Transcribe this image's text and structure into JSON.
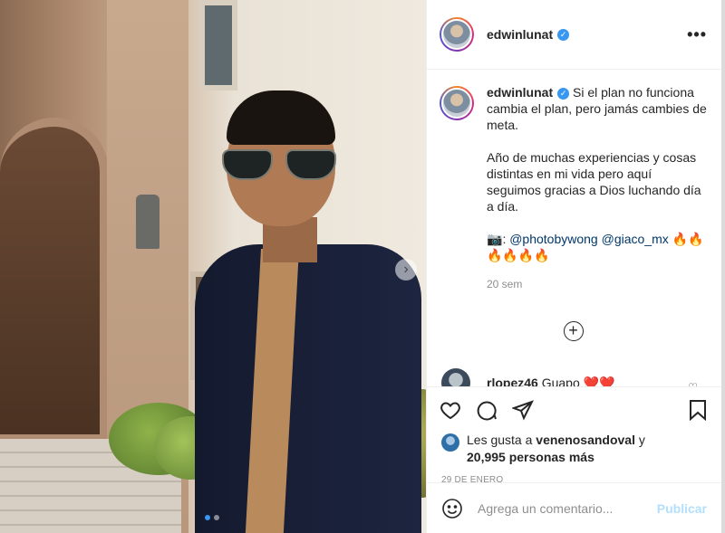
{
  "post": {
    "photo_alt": "Post photo",
    "carousel_dots": 2,
    "carousel_active": 1
  },
  "header": {
    "username": "edwinlunat",
    "verified_icon": "verified-badge-icon",
    "more_icon": "more-options-icon",
    "more_glyph": "•••"
  },
  "caption": {
    "username": "edwinlunat",
    "paragraph1": "Si el plan no funciona cambia el plan, pero jamás cambies de meta.",
    "paragraph2": "Año de muchas experiencias y cosas distintas en mi vida pero aquí seguimos gracias a Dios luchando día a día.",
    "camera_emoji": "📷",
    "credit_sep": ": ",
    "mention1": "@photobywong",
    "mention2": "@giaco_mx",
    "fire_emojis": "🔥🔥🔥🔥🔥🔥",
    "time": "20 sem"
  },
  "load_more": {
    "glyph": "+"
  },
  "comments": [
    {
      "username": "rlopez46",
      "text": "Guapo",
      "hearts": "❤️❤️"
    }
  ],
  "actions": {
    "like_icon": "heart-icon",
    "comment_icon": "comment-icon",
    "share_icon": "share-icon",
    "save_icon": "bookmark-icon"
  },
  "likes": {
    "prefix": "Les gusta a",
    "liker": "venenosandoval",
    "conj": "y",
    "count": "20,995 personas más"
  },
  "date": "29 DE ENERO",
  "add_comment": {
    "placeholder": "Agrega un comentario...",
    "publish_label": "Publicar",
    "emoji_icon": "emoji-icon"
  }
}
